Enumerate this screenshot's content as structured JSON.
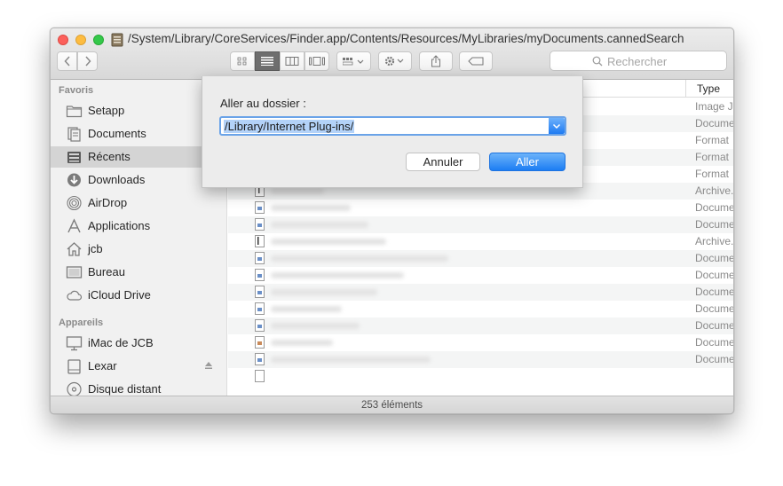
{
  "window": {
    "title": "/System/Library/CoreServices/Finder.app/Contents/Resources/MyLibraries/myDocuments.cannedSearch"
  },
  "toolbar": {
    "search_placeholder": "Rechercher",
    "view_mode_selected": "list"
  },
  "sidebar": {
    "favorites_title": "Favoris",
    "favorites": [
      {
        "label": "Setapp",
        "icon": "folder-icon"
      },
      {
        "label": "Documents",
        "icon": "documents-icon"
      },
      {
        "label": "Récents",
        "icon": "recents-icon",
        "selected": true
      },
      {
        "label": "Downloads",
        "icon": "downloads-icon"
      },
      {
        "label": "AirDrop",
        "icon": "airdrop-icon"
      },
      {
        "label": "Applications",
        "icon": "applications-icon"
      },
      {
        "label": "jcb",
        "icon": "home-icon"
      },
      {
        "label": "Bureau",
        "icon": "desktop-icon"
      },
      {
        "label": "iCloud Drive",
        "icon": "cloud-icon"
      }
    ],
    "devices_title": "Appareils",
    "devices": [
      {
        "label": "iMac de JCB",
        "icon": "imac-icon"
      },
      {
        "label": "Lexar",
        "icon": "drive-icon"
      },
      {
        "label": "Disque distant",
        "icon": "disc-icon"
      }
    ]
  },
  "file_list": {
    "type_header": "Type",
    "types": [
      "Image J",
      "Docume",
      "Format",
      "Format",
      "Format",
      "Archive.",
      "Docume",
      "Docume",
      "Archive.",
      "Docume",
      "Docume",
      "Docume",
      "Docume",
      "Docume",
      "Docume",
      "Docume"
    ]
  },
  "status": {
    "count_text": "253 éléments"
  },
  "dialog": {
    "label": "Aller au dossier :",
    "path_value": "/Library/Internet Plug-ins/",
    "cancel_label": "Annuler",
    "go_label": "Aller"
  },
  "colors": {
    "accent": "#1f7bf2",
    "selection_highlight": "#b3d2f8",
    "sidebar_selected": "#d4d4d4"
  }
}
